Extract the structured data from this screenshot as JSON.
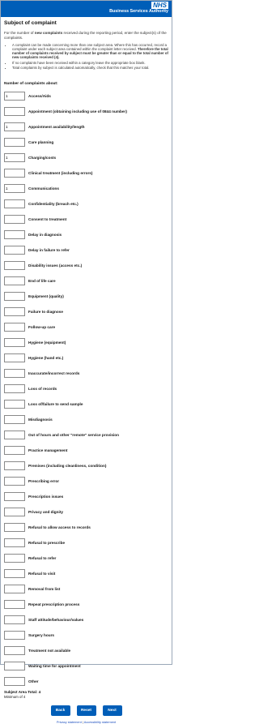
{
  "header": {
    "logo": "NHS",
    "org_name": "Business Services Authority"
  },
  "page": {
    "title": "Subject of complaint",
    "intro_before": "For the number of ",
    "intro_bold": "new complaints",
    "intro_after": " received during the reporting period, enter the subject(s) of the complaints.",
    "notes": [
      {
        "text": "A complaint can be made concerning more than one subject area. Where this has occurred, record a complaint under each subject area contained within the complaint letter received. ",
        "bold": "Therefore the total number of complaints received by subject must be greater than or equal to the total number of new complaints received (4)."
      },
      {
        "text": "If no complaints have been received within a category leave the appropriate box blank.",
        "bold": ""
      },
      {
        "text": "Total complaints by subject is calculated automatically, check that this matches your total.",
        "bold": ""
      }
    ]
  },
  "list": {
    "heading": "Number of complaints about:",
    "rows": [
      {
        "label": "Access/Aids",
        "value": "1"
      },
      {
        "label": "Appointment (obtaining including use of 0844 number)",
        "value": ""
      },
      {
        "label": "Appointment availability/length",
        "value": "1"
      },
      {
        "label": "Care planning",
        "value": ""
      },
      {
        "label": "Charging/costs",
        "value": "1"
      },
      {
        "label": "Clinical treatment (including errors)",
        "value": ""
      },
      {
        "label": "Communications",
        "value": "1"
      },
      {
        "label": "Confidentiality (breach etc.)",
        "value": ""
      },
      {
        "label": "Consent to treatment",
        "value": ""
      },
      {
        "label": "Delay in diagnosis",
        "value": ""
      },
      {
        "label": "Delay in failure to refer",
        "value": ""
      },
      {
        "label": "Disability issues (access etc.)",
        "value": ""
      },
      {
        "label": "End of life care",
        "value": ""
      },
      {
        "label": "Equipment (quality)",
        "value": ""
      },
      {
        "label": "Failure to diagnose",
        "value": ""
      },
      {
        "label": "Follow-up care",
        "value": ""
      },
      {
        "label": "Hygiene (equipment)",
        "value": ""
      },
      {
        "label": "Hygiene (hand etc.)",
        "value": ""
      },
      {
        "label": "Inaccurate/incorrect records",
        "value": ""
      },
      {
        "label": "Loss of records",
        "value": ""
      },
      {
        "label": "Loss of/failure to send sample",
        "value": ""
      },
      {
        "label": "Misdiagnosis",
        "value": ""
      },
      {
        "label": "Out of hours and other \"remote\" service provision",
        "value": ""
      },
      {
        "label": "Practice management",
        "value": ""
      },
      {
        "label": "Premises (including cleanliness, condition)",
        "value": ""
      },
      {
        "label": "Prescribing error",
        "value": ""
      },
      {
        "label": "Prescription issues",
        "value": ""
      },
      {
        "label": "Privacy and dignity",
        "value": ""
      },
      {
        "label": "Refusal to allow access to records",
        "value": ""
      },
      {
        "label": "Refusal to prescribe",
        "value": ""
      },
      {
        "label": "Refusal to refer",
        "value": ""
      },
      {
        "label": "Refusal to visit",
        "value": ""
      },
      {
        "label": "Removal from list",
        "value": ""
      },
      {
        "label": "Repeat prescription process",
        "value": ""
      },
      {
        "label": "Staff attitude/behaviour/values",
        "value": ""
      },
      {
        "label": "Surgery hours",
        "value": ""
      },
      {
        "label": "Treatment not available",
        "value": ""
      },
      {
        "label": "Waiting time for appointment",
        "value": ""
      },
      {
        "label": "Other",
        "value": ""
      }
    ]
  },
  "summary": {
    "total_label": "Subject Area Total: 4",
    "minimum_label": "Minimum of 4"
  },
  "buttons": {
    "back": "Back",
    "reset": "Reset",
    "next": "Next"
  },
  "footer": {
    "privacy": "Privacy statement",
    "separator": "|",
    "accessibility": "Accessibility statement"
  },
  "colors": {
    "brand_blue": "#005eb8",
    "link": "#1d4fbf"
  }
}
